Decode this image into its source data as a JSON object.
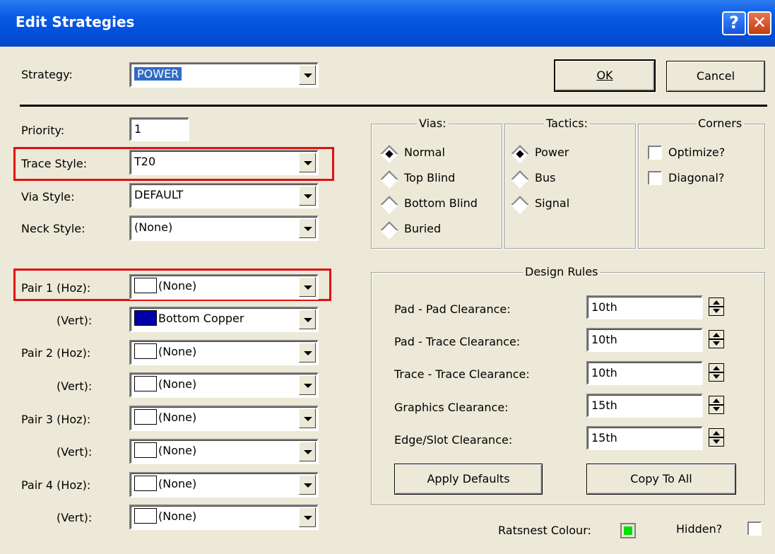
{
  "window": {
    "title": "Edit Strategies",
    "help_glyph": "?",
    "close_glyph": "✕"
  },
  "strategy": {
    "label": "Strategy:",
    "value": "POWER"
  },
  "buttons": {
    "ok": "OK",
    "cancel": "Cancel",
    "apply_defaults": "Apply Defaults",
    "copy_to_all": "Copy To All"
  },
  "priority": {
    "label": "Priority:",
    "value": "1"
  },
  "trace_style": {
    "label": "Trace Style:",
    "value": "T20"
  },
  "via_style": {
    "label": "Via Style:",
    "value": "DEFAULT"
  },
  "neck_style": {
    "label": "Neck Style:",
    "value": "(None)"
  },
  "pairs": [
    {
      "hoz_label": "Pair 1 (Hoz):",
      "hoz_value": "(None)",
      "hoz_color": "#ffffff",
      "vert_label": "(Vert):",
      "vert_value": "Bottom Copper",
      "vert_color": "#0000a8"
    },
    {
      "hoz_label": "Pair 2 (Hoz):",
      "hoz_value": "(None)",
      "hoz_color": "#ffffff",
      "vert_label": "(Vert):",
      "vert_value": "(None)",
      "vert_color": "#ffffff"
    },
    {
      "hoz_label": "Pair 3 (Hoz):",
      "hoz_value": "(None)",
      "hoz_color": "#ffffff",
      "vert_label": "(Vert):",
      "vert_value": "(None)",
      "vert_color": "#ffffff"
    },
    {
      "hoz_label": "Pair 4 (Hoz):",
      "hoz_value": "(None)",
      "hoz_color": "#ffffff",
      "vert_label": "(Vert):",
      "vert_value": "(None)",
      "vert_color": "#ffffff"
    }
  ],
  "vias": {
    "title": "Vias:",
    "options": [
      {
        "label": "Normal",
        "checked": true
      },
      {
        "label": "Top Blind",
        "checked": false
      },
      {
        "label": "Bottom Blind",
        "checked": false
      },
      {
        "label": "Buried",
        "checked": false
      }
    ]
  },
  "tactics": {
    "title": "Tactics:",
    "options": [
      {
        "label": "Power",
        "checked": true
      },
      {
        "label": "Bus",
        "checked": false
      },
      {
        "label": "Signal",
        "checked": false
      }
    ]
  },
  "corners": {
    "title": "Corners",
    "options": [
      {
        "label": "Optimize?",
        "checked": false
      },
      {
        "label": "Diagonal?",
        "checked": false
      }
    ]
  },
  "design_rules": {
    "title": "Design Rules",
    "rows": [
      {
        "label": "Pad - Pad Clearance:",
        "value": "10th"
      },
      {
        "label": "Pad - Trace Clearance:",
        "value": "10th"
      },
      {
        "label": "Trace - Trace Clearance:",
        "value": "10th"
      },
      {
        "label": "Graphics Clearance:",
        "value": "15th"
      },
      {
        "label": "Edge/Slot Clearance:",
        "value": "15th"
      }
    ]
  },
  "ratsnest": {
    "label": "Ratsnest Colour:",
    "color": "#00e000"
  },
  "hidden": {
    "label": "Hidden?",
    "checked": false
  },
  "colors": {
    "title_bar": "#0a5ae6",
    "dialog_bg": "#ece9d8",
    "highlight_box": "#e01010",
    "selection": "#316ac5"
  }
}
